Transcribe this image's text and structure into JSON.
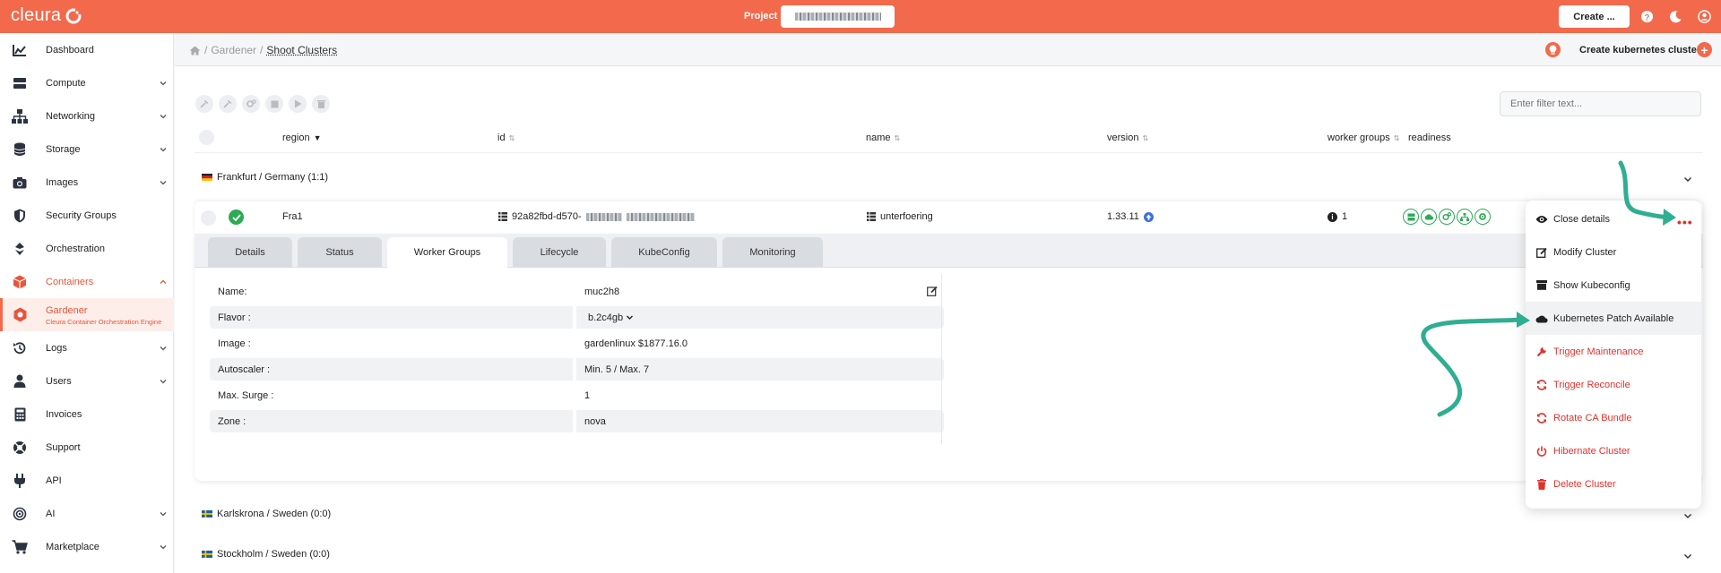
{
  "app": {
    "logo_text": "cleura",
    "project_label": "Project",
    "create_label": "Create ..."
  },
  "sidebar": {
    "items": [
      {
        "label": "Dashboard"
      },
      {
        "label": "Compute"
      },
      {
        "label": "Networking"
      },
      {
        "label": "Storage"
      },
      {
        "label": "Images"
      },
      {
        "label": "Security Groups"
      },
      {
        "label": "Orchestration"
      },
      {
        "label": "Containers"
      },
      {
        "label": "Gardener",
        "sub": "Cleura Container Orchestration Engine"
      },
      {
        "label": "Logs"
      },
      {
        "label": "Users"
      },
      {
        "label": "Invoices"
      },
      {
        "label": "Support"
      },
      {
        "label": "API"
      },
      {
        "label": "AI"
      },
      {
        "label": "Marketplace"
      }
    ]
  },
  "header": {
    "breadcrumb_sep": "/",
    "breadcrumb_parent": "Gardener",
    "breadcrumb_current": "Shoot Clusters",
    "create_kube_label": "Create kubernetes cluster"
  },
  "filter": {
    "placeholder": "Enter filter text..."
  },
  "table": {
    "columns": [
      "region",
      "id",
      "name",
      "version",
      "worker groups",
      "readiness"
    ]
  },
  "groups": [
    {
      "label": "Frankfurt / Germany (1:1)"
    },
    {
      "label": "Karlskrona / Sweden (0:0)"
    },
    {
      "label": "Stockholm / Sweden (0:0)"
    }
  ],
  "cluster": {
    "region": "Fra1",
    "id_prefix": "92a82fbd-d570-",
    "name": "unterfoering",
    "version": "1.33.11",
    "worker_groups": "1"
  },
  "tabs": [
    "Details",
    "Status",
    "Worker Groups",
    "Lifecycle",
    "KubeConfig",
    "Monitoring"
  ],
  "worker_group": {
    "rows": [
      {
        "key": "Name:",
        "value": "muc2h8"
      },
      {
        "key": "Flavor :",
        "value": "b.2c4gb"
      },
      {
        "key": "Image :",
        "value": "gardenlinux $1877.16.0"
      },
      {
        "key": "Autoscaler :",
        "value": "Min. 5 / Max. 7"
      },
      {
        "key": "Max. Surge :",
        "value": "1"
      },
      {
        "key": "Zone :",
        "value": "nova"
      }
    ]
  },
  "menu": {
    "items": [
      {
        "label": "Close details",
        "icon": "eye-icon"
      },
      {
        "label": "Modify Cluster",
        "icon": "edit-icon"
      },
      {
        "label": "Show Kubeconfig",
        "icon": "archive-icon"
      },
      {
        "label": "Kubernetes Patch Available",
        "icon": "cloud-icon"
      },
      {
        "label": "Trigger Maintenance",
        "icon": "wrench-icon"
      },
      {
        "label": "Trigger Reconcile",
        "icon": "refresh-icon"
      },
      {
        "label": "Rotate CA Bundle",
        "icon": "refresh-icon"
      },
      {
        "label": "Hibernate Cluster",
        "icon": "power-icon"
      },
      {
        "label": "Delete Cluster",
        "icon": "trash-icon"
      }
    ]
  },
  "colors": {
    "brand": "#f2694b",
    "success": "#2daa55",
    "danger": "#e0322c",
    "arrow": "#2fae92"
  }
}
